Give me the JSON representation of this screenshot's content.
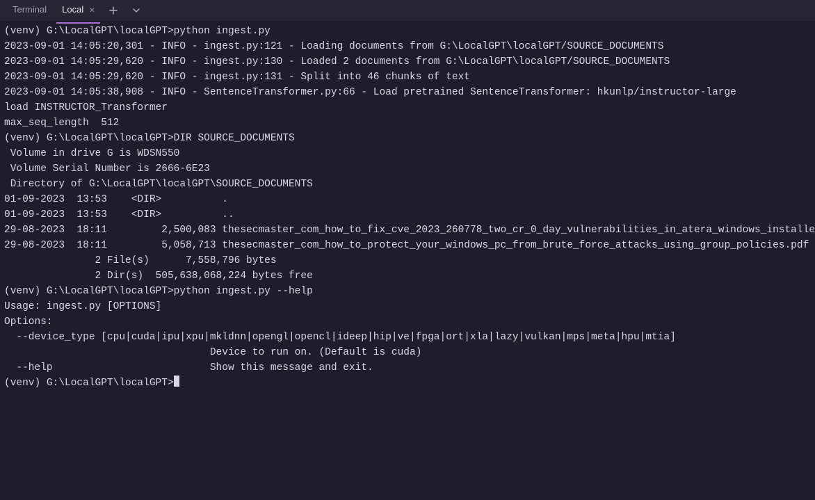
{
  "tabbar": {
    "section_label": "Terminal",
    "active_tab": "Local",
    "close_glyph": "×"
  },
  "terminal": {
    "lines": [
      "(venv) G:\\LocalGPT\\localGPT>python ingest.py",
      "2023-09-01 14:05:20,301 - INFO - ingest.py:121 - Loading documents from G:\\LocalGPT\\localGPT/SOURCE_DOCUMENTS",
      "2023-09-01 14:05:29,620 - INFO - ingest.py:130 - Loaded 2 documents from G:\\LocalGPT\\localGPT/SOURCE_DOCUMENTS",
      "2023-09-01 14:05:29,620 - INFO - ingest.py:131 - Split into 46 chunks of text",
      "2023-09-01 14:05:38,908 - INFO - SentenceTransformer.py:66 - Load pretrained SentenceTransformer: hkunlp/instructor-large",
      "load INSTRUCTOR_Transformer",
      "max_seq_length  512",
      "",
      "(venv) G:\\LocalGPT\\localGPT>DIR SOURCE_DOCUMENTS",
      " Volume in drive G is WDSN550",
      " Volume Serial Number is 2666-6E23",
      "",
      " Directory of G:\\LocalGPT\\localGPT\\SOURCE_DOCUMENTS",
      "",
      "01-09-2023  13:53    <DIR>          .",
      "01-09-2023  13:53    <DIR>          ..",
      "29-08-2023  18:11         2,500,083 thesecmaster_com_how_to_fix_cve_2023_260778_two_cr_0_day_vulnerabilities_in_atera_windows_installers.pdf",
      "29-08-2023  18:11         5,058,713 thesecmaster_com_how_to_protect_your_windows_pc_from_brute_force_attacks_using_group_policies.pdf",
      "               2 File(s)      7,558,796 bytes",
      "               2 Dir(s)  505,638,068,224 bytes free",
      "",
      "(venv) G:\\LocalGPT\\localGPT>python ingest.py --help",
      "Usage: ingest.py [OPTIONS]",
      "",
      "Options:",
      "  --device_type [cpu|cuda|ipu|xpu|mkldnn|opengl|opencl|ideep|hip|ve|fpga|ort|xla|lazy|vulkan|mps|meta|hpu|mtia]",
      "                                  Device to run on. (Default is cuda)",
      "  --help                          Show this message and exit.",
      "",
      "(venv) G:\\LocalGPT\\localGPT>"
    ]
  }
}
